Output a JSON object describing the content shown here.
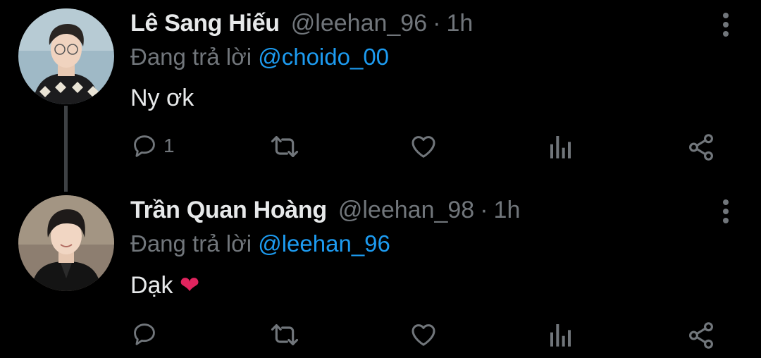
{
  "tweets": [
    {
      "author_name": "Lê Sang Hiếu",
      "handle": "@leehan_96",
      "separator": "·",
      "time": "1h",
      "reply_prefix": "Đang trả lời",
      "reply_to": "@choido_00",
      "text": "Ny ơk",
      "reply_count": "1"
    },
    {
      "author_name": "Trần Quan Hoàng",
      "handle": "@leehan_98",
      "separator": "·",
      "time": "1h",
      "reply_prefix": "Đang trả lời",
      "reply_to": "@leehan_96",
      "text": "Dạk",
      "emoji": "❤",
      "reply_count": ""
    }
  ],
  "icons": {
    "reply": "reply-icon",
    "retweet": "retweet-icon",
    "like": "heart-icon",
    "stats": "stats-icon",
    "share": "share-icon",
    "more": "more-vertical-icon"
  },
  "colors": {
    "background": "#000000",
    "text": "#e7e9ea",
    "muted": "#71767b",
    "link": "#1d9bf0",
    "thread_line": "#3e4144"
  }
}
